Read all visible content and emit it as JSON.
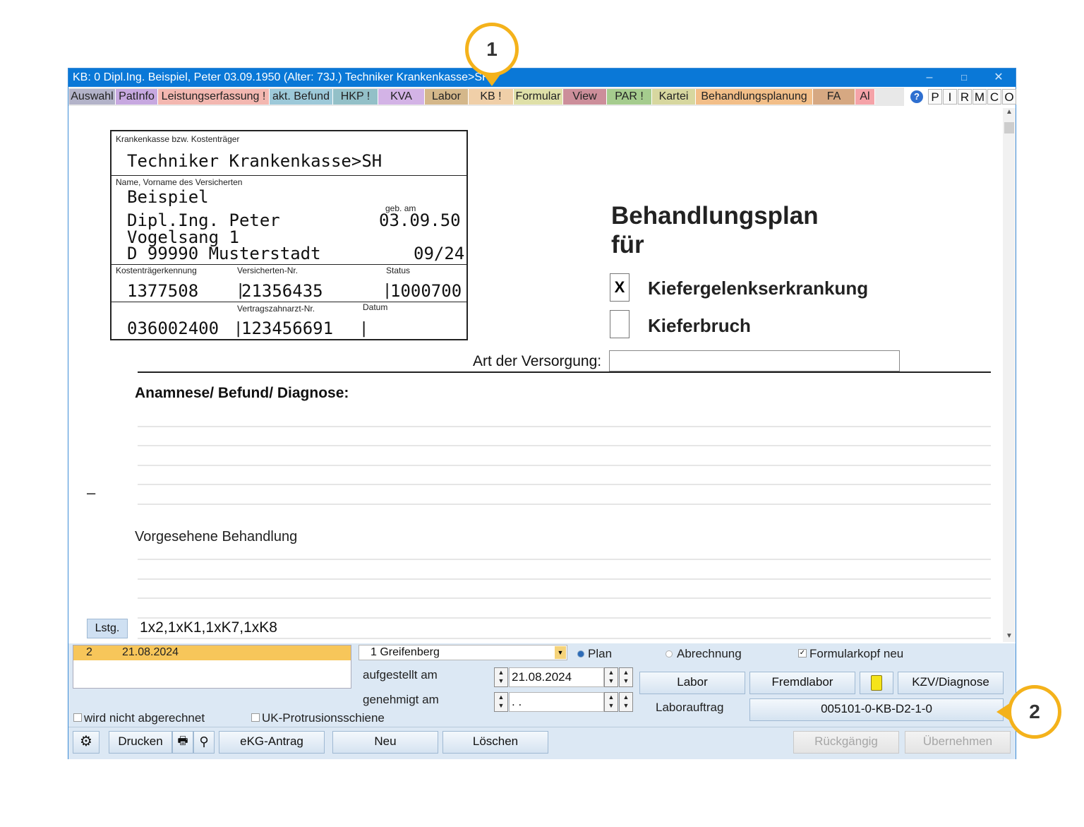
{
  "window": {
    "title": "KB: 0  Dipl.Ing. Beispiel, Peter  03.09.1950 (Alter: 73J.)  Techniker Krankenkasse>SH",
    "minimize": "–",
    "maximize": "□",
    "close": "✕"
  },
  "tabs": [
    {
      "label": "Auswahl",
      "color": "#b3b3c9"
    },
    {
      "label": "PatInfo",
      "color": "#c7a8e0"
    },
    {
      "label": "Leistungserfassung !",
      "color": "#f3b7b0"
    },
    {
      "label": "akt. Befund",
      "color": "#9dc9d9"
    },
    {
      "label": "HKP !",
      "color": "#93c0c8"
    },
    {
      "label": "KVA",
      "color": "#d3b3e6"
    },
    {
      "label": "Labor",
      "color": "#d4b78a"
    },
    {
      "label": "KB !",
      "color": "#f0cfa8"
    },
    {
      "label": "Formular",
      "color": "#dfe0a8"
    },
    {
      "label": "View",
      "color": "#cc8e9a"
    },
    {
      "label": "PAR !",
      "color": "#a5cc8e"
    },
    {
      "label": "Kartei",
      "color": "#d7d79f"
    },
    {
      "label": "Behandlungsplanung",
      "color": "#f2be88"
    },
    {
      "label": "FA",
      "color": "#d6a882"
    },
    {
      "label": "Al",
      "color": "#f5a3a8"
    }
  ],
  "right_tabs": [
    "P",
    "I",
    "R",
    "M",
    "C",
    "O"
  ],
  "help_icon": "?",
  "form": {
    "kasse_label": "Krankenkasse bzw. Kostenträger",
    "kasse": "Techniker Krankenkasse>SH",
    "name_label": "Name, Vorname des Versicherten",
    "name1": "Beispiel",
    "name2": "Dipl.Ing. Peter",
    "street": "Vogelsang 1",
    "city": "D 99990 Musterstadt",
    "geb_label": "geb. am",
    "dob": "03.09.50",
    "valid": "09/24",
    "kt_label": "Kostenträgerkennung",
    "kt": "1377508",
    "vers_label": "Versicherten-Nr.",
    "vers": "21356435",
    "status_label": "Status",
    "status": "1000700",
    "bsnr": "036002400",
    "vz_label": "Vertragszahnarzt-Nr.",
    "vz": "123456691",
    "datum_label": "Datum",
    "heading1": "Behandlungsplan",
    "heading2": "für",
    "option1_mark": "X",
    "option1": "Kiefergelenkserkrankung",
    "option2": "Kieferbruch",
    "versorgung_label": "Art der Versorgung:",
    "anamnese": "Anamnese/ Befund/ Diagnose:",
    "dash": "–",
    "vorgesehen": "Vorgesehene Behandlung",
    "lstg_button": "Lstg.",
    "lstg_value": "1x2,1xK1,1xK7,1xK8"
  },
  "panel": {
    "list_row": {
      "nr": "2",
      "date": "21.08.2024"
    },
    "practitioner": "1 Greifenberg",
    "plan": "Plan",
    "abrechnung": "Abrechnung",
    "formularkopf": "Formularkopf neu",
    "formularkopf_checked": "✓",
    "aufgestellt_label": "aufgestellt am",
    "aufgestellt": "21.08.2024",
    "genehmigt_label": "genehmigt am",
    "genehmigt": " .  .",
    "labor": "Labor",
    "fremdlabor": "Fremdlabor",
    "kzv": "KZV/Diagnose",
    "laborauftrag_label": "Laborauftrag",
    "laborauftrag": "005101-0-KB-D2-1-0",
    "nicht_abgerechnet": "wird nicht abgerechnet",
    "uk": "UK-Protrusionsschiene",
    "drucken": "Drucken",
    "ekg": "eKG-Antrag",
    "neu": "Neu",
    "loeschen": "Löschen",
    "rueckgaengig": "Rückgängig",
    "uebernehmen": "Übernehmen"
  },
  "callouts": [
    "1",
    "2"
  ],
  "colors": {
    "titlebar": "#0a78d7",
    "highlight_row": "#f7c65a",
    "callout": "#f4b21b"
  }
}
